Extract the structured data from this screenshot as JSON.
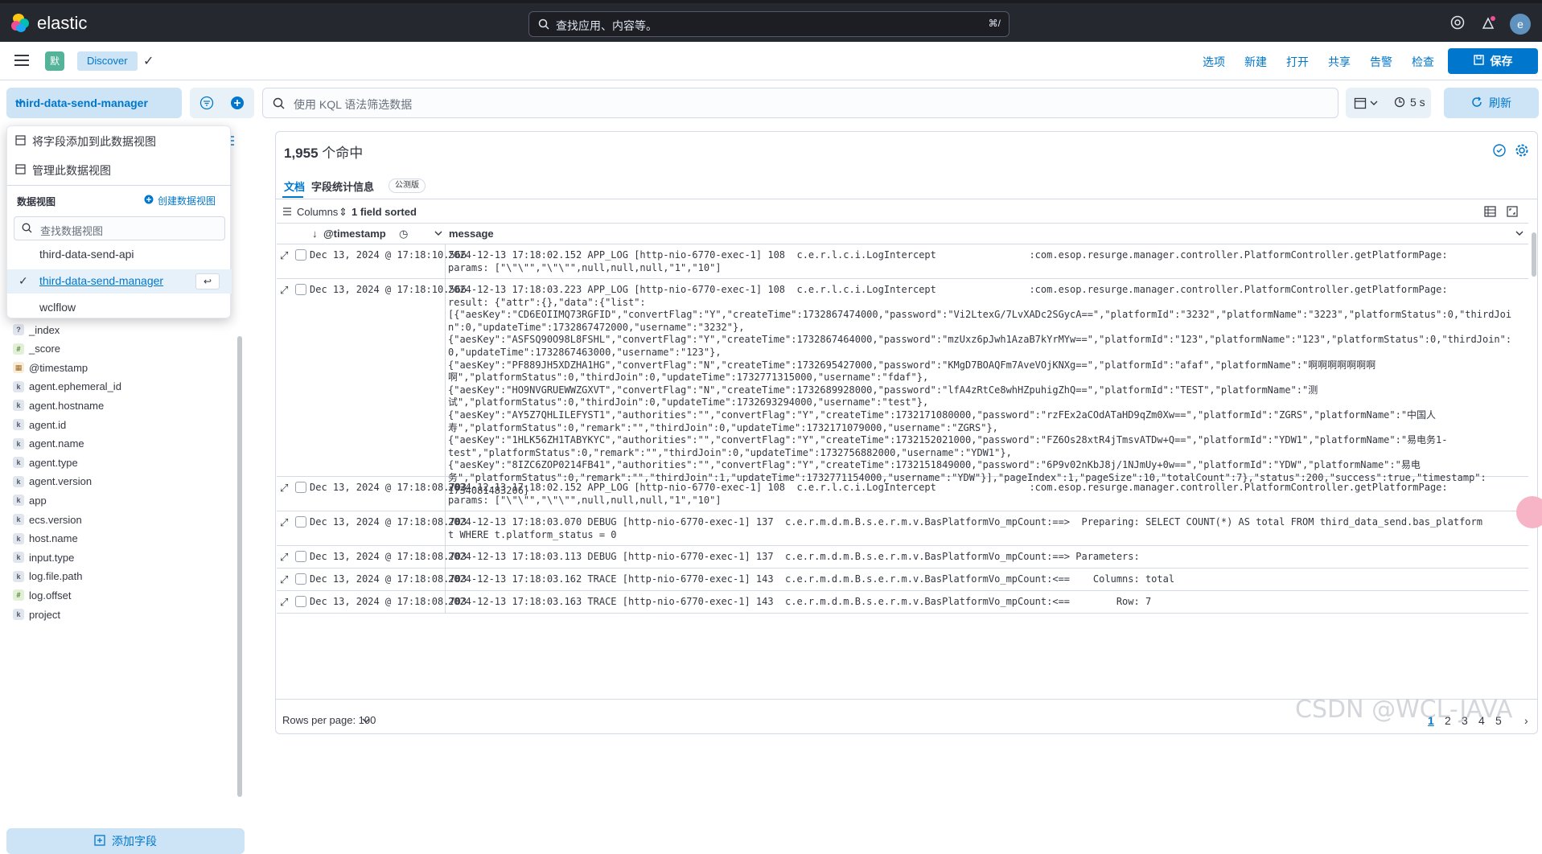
{
  "app": {
    "brand": "elastic",
    "global_search_placeholder": "查找应用、内容等。",
    "global_search_shortcut": "⌘/",
    "avatar_initial": "e",
    "space_badge": "默",
    "breadcrumb": "Discover"
  },
  "toolbar": {
    "options": "选项",
    "new": "新建",
    "open": "打开",
    "share": "共享",
    "alert": "告警",
    "inspect": "检查",
    "save": "保存"
  },
  "query_bar": {
    "data_view": "third-data-send-manager",
    "kql_placeholder": "使用 KQL 语法筛选数据",
    "refresh_interval": "5 s",
    "refresh": "刷新"
  },
  "popover": {
    "add_field": "将字段添加到此数据视图",
    "manage": "管理此数据视图",
    "section_title": "数据视图",
    "create": "创建数据视图",
    "search_placeholder": "查找数据视图",
    "options": [
      "third-data-send-api",
      "third-data-send-manager",
      "wclflow"
    ],
    "selected_index": 1
  },
  "sidebar": {
    "fields": [
      {
        "type": "?",
        "name": "_index"
      },
      {
        "type": "#",
        "name": "_score"
      },
      {
        "type": "date",
        "name": "@timestamp"
      },
      {
        "type": "k",
        "name": "agent.ephemeral_id"
      },
      {
        "type": "k",
        "name": "agent.hostname"
      },
      {
        "type": "k",
        "name": "agent.id"
      },
      {
        "type": "k",
        "name": "agent.name"
      },
      {
        "type": "k",
        "name": "agent.type"
      },
      {
        "type": "k",
        "name": "agent.version"
      },
      {
        "type": "k",
        "name": "app"
      },
      {
        "type": "k",
        "name": "ecs.version"
      },
      {
        "type": "k",
        "name": "host.name"
      },
      {
        "type": "k",
        "name": "input.type"
      },
      {
        "type": "k",
        "name": "log.file.path"
      },
      {
        "type": "#",
        "name": "log.offset"
      },
      {
        "type": "k",
        "name": "project"
      }
    ],
    "add_field_button": "添加字段"
  },
  "main": {
    "hits_count": "1,955",
    "hits_suffix": " 个命中",
    "tabs": [
      "文档",
      "字段统计信息"
    ],
    "tab_badge": "公测版",
    "columns_label": "Columns",
    "sorted_label": "1 field sorted",
    "col_timestamp": "@timestamp",
    "col_message": "message",
    "rows": [
      {
        "ts": "Dec 13, 2024 @ 17:18:10.566",
        "msg": "2024-12-13 17:18:02.152 APP_LOG [http-nio-6770-exec-1] 108  c.e.r.l.c.i.LogIntercept                :com.esop.resurge.manager.controller.PlatformController.getPlatformPage:\nparams: [\"\\\"\\\"\",\"\\\"\\\"\",null,null,null,\"1\",\"10\"]"
      },
      {
        "ts": "Dec 13, 2024 @ 17:18:10.566",
        "msg": "2024-12-13 17:18:03.223 APP_LOG [http-nio-6770-exec-1] 108  c.e.r.l.c.i.LogIntercept                :com.esop.resurge.manager.controller.PlatformController.getPlatformPage:\nresult: {\"attr\":{},\"data\":{\"list\":\n[{\"aesKey\":\"CD6EOIIMQ73RGFID\",\"convertFlag\":\"Y\",\"createTime\":1732867474000,\"password\":\"Vi2LtexG/7LvXADc2SGycA==\",\"platformId\":\"3232\",\"platformName\":\"3223\",\"platformStatus\":0,\"thirdJoin\":0,\"updateTime\":1732867472000,\"username\":\"3232\"},\n{\"aesKey\":\"ASFSQ90O98L8FSHL\",\"convertFlag\":\"Y\",\"createTime\":1732867464000,\"password\":\"mzUxz6pJwh1AzaB7kYrMYw==\",\"platformId\":\"123\",\"platformName\":\"123\",\"platformStatus\":0,\"thirdJoin\":0,\"updateTime\":1732867463000,\"username\":\"123\"},\n{\"aesKey\":\"PF889JH5XDZHA1HG\",\"convertFlag\":\"N\",\"createTime\":1732695427000,\"password\":\"KMgD7BOAQFm7AveVOjKNXg==\",\"platformId\":\"afaf\",\"platformName\":\"啊啊啊啊啊啊啊\n啊\",\"platformStatus\":0,\"thirdJoin\":0,\"updateTime\":1732771315000,\"username\":\"fdaf\"},\n{\"aesKey\":\"HO9NVGRUEWWZGXVT\",\"convertFlag\":\"N\",\"createTime\":1732689928000,\"password\":\"lfA4zRtCe8whHZpuhigZhQ==\",\"platformId\":\"TEST\",\"platformName\":\"测\n试\",\"platformStatus\":0,\"thirdJoin\":0,\"updateTime\":1732693294000,\"username\":\"test\"},\n{\"aesKey\":\"AY5Z7QHLILEFYST1\",\"authorities\":\"\",\"convertFlag\":\"Y\",\"createTime\":1732171080000,\"password\":\"rzFEx2aCOdATaHD9qZm0Xw==\",\"platformId\":\"ZGRS\",\"platformName\":\"中国人\n寿\",\"platformStatus\":0,\"remark\":\"\",\"thirdJoin\":0,\"updateTime\":1732171079000,\"username\":\"ZGRS\"},\n{\"aesKey\":\"1HLK56ZH1TABYKYC\",\"authorities\":\"\",\"convertFlag\":\"Y\",\"createTime\":1732152021000,\"password\":\"FZ6Os28xtR4jTmsvATDw+Q==\",\"platformId\":\"YDW1\",\"platformName\":\"易电务1-\ntest\",\"platformStatus\":0,\"remark\":\"\",\"thirdJoin\":0,\"updateTime\":1732756882000,\"username\":\"YDW1\"},\n{\"aesKey\":\"8IZC6ZOP0214FB41\",\"authorities\":\"\",\"convertFlag\":\"Y\",\"createTime\":1732151849000,\"password\":\"6P9v02nKbJ8j/1NJmUy+0w==\",\"platformId\":\"YDW\",\"platformName\":\"易电\n务\",\"platformStatus\":0,\"remark\":\"\",\"thirdJoin\":1,\"updateTime\":1732771154000,\"username\":\"YDW\"}],\"pageIndex\":1,\"pageSize\":10,\"totalCount\":7},\"status\":200,\"success\":true,\"timestamp\":\n1734081483206}"
      },
      {
        "ts": "Dec 13, 2024 @ 17:18:08.703",
        "msg": "2024-12-13 17:18:02.152 APP_LOG [http-nio-6770-exec-1] 108  c.e.r.l.c.i.LogIntercept                :com.esop.resurge.manager.controller.PlatformController.getPlatformPage:\nparams: [\"\\\"\\\"\",\"\\\"\\\"\",null,null,null,\"1\",\"10\"]"
      },
      {
        "ts": "Dec 13, 2024 @ 17:18:08.703",
        "msg": "2024-12-13 17:18:03.070 DEBUG [http-nio-6770-exec-1] 137  c.e.r.m.d.m.B.s.e.r.m.v.BasPlatformVo_mpCount:==>  Preparing: SELECT COUNT(*) AS total FROM third_data_send.bas_platform\nt WHERE t.platform_status = 0"
      },
      {
        "ts": "Dec 13, 2024 @ 17:18:08.703",
        "msg": "2024-12-13 17:18:03.113 DEBUG [http-nio-6770-exec-1] 137  c.e.r.m.d.m.B.s.e.r.m.v.BasPlatformVo_mpCount:==> Parameters:"
      },
      {
        "ts": "Dec 13, 2024 @ 17:18:08.703",
        "msg": "2024-12-13 17:18:03.162 TRACE [http-nio-6770-exec-1] 143  c.e.r.m.d.m.B.s.e.r.m.v.BasPlatformVo_mpCount:<==    Columns: total"
      },
      {
        "ts": "Dec 13, 2024 @ 17:18:08.703",
        "msg": "2024-12-13 17:18:03.163 TRACE [http-nio-6770-exec-1] 143  c.e.r.m.d.m.B.s.e.r.m.v.BasPlatformVo_mpCount:<==        Row: 7"
      }
    ],
    "rows_per_page": "Rows per page: 100",
    "pages": [
      "1",
      "2",
      "3",
      "4",
      "5"
    ],
    "current_page": "1"
  },
  "watermark": "CSDN @WCL-JAVA"
}
